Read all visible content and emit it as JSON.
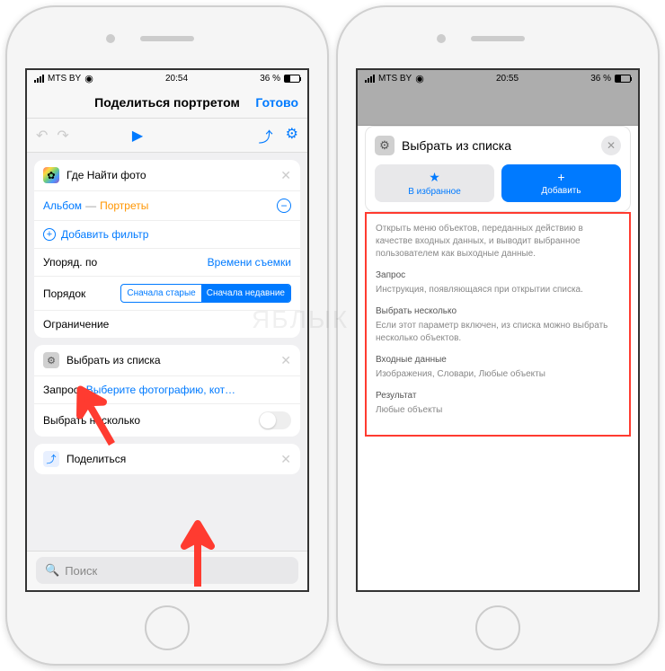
{
  "status": {
    "carrier": "MTS BY",
    "time_left": "20:54",
    "time_right": "20:55",
    "battery": "36 %"
  },
  "nav": {
    "title": "Поделиться портретом",
    "done": "Готово"
  },
  "photos_card": {
    "title": "Где Найти фото",
    "album_label": "Альбом",
    "album_value": "Портреты",
    "add_filter": "Добавить фильтр",
    "sort_by_label": "Упоряд. по",
    "sort_by_value": "Времени съемки",
    "order_label": "Порядок",
    "order_old": "Сначала старые",
    "order_new": "Сначала недавние",
    "limit_label": "Ограничение"
  },
  "choose_card": {
    "title": "Выбрать из списка",
    "prompt_label": "Запрос",
    "prompt_value": "Выберите фотографию, которой н…",
    "multi_label": "Выбрать несколько"
  },
  "share_card": {
    "title": "Поделиться"
  },
  "search": {
    "placeholder": "Поиск"
  },
  "panel": {
    "title": "Выбрать из списка",
    "fav_label": "В избранное",
    "add_label": "Добавить",
    "desc": "Открыть меню объектов, переданных действию в качестве входных данных, и выводит выбранное пользователем как выходные данные.",
    "sec1_title": "Запрос",
    "sec1_text": "Инструкция, появляющаяся при открытии списка.",
    "sec2_title": "Выбрать несколько",
    "sec2_text": "Если этот параметр включен, из списка можно выбрать несколько объектов.",
    "sec3_title": "Входные данные",
    "sec3_text": "Изображения, Словари, Любые объекты",
    "sec4_title": "Результат",
    "sec4_text": "Любые объекты"
  },
  "watermark": "ЯБЛЫК"
}
